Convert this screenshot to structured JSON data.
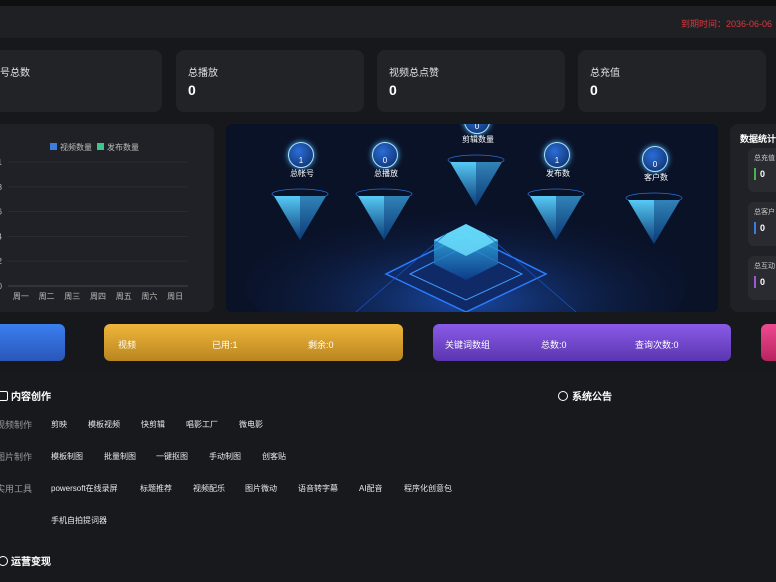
{
  "header": {
    "expire_text": "到期时间：2036-06-06"
  },
  "stats": [
    {
      "label": "号总数",
      "value": ""
    },
    {
      "label": "总播放",
      "value": "0"
    },
    {
      "label": "视频总点赞",
      "value": "0"
    },
    {
      "label": "总充值",
      "value": "0"
    }
  ],
  "chart_data": {
    "type": "bar",
    "categories": [
      "周一",
      "周二",
      "周三",
      "周四",
      "周五",
      "周六",
      "周日"
    ],
    "series": [
      {
        "name": "视频数量",
        "values": [
          0,
          0,
          0,
          0,
          0,
          0,
          0
        ],
        "color": "#3b7ddd"
      },
      {
        "name": "发布数量",
        "values": [
          0,
          0,
          0,
          0,
          0,
          0,
          0
        ],
        "color": "#3fc48a"
      }
    ],
    "yticks": [
      "1",
      "8",
      "6",
      "4",
      "2",
      "0"
    ],
    "ylim": [
      0,
      1
    ],
    "legend": "top-center",
    "grid": true
  },
  "center": {
    "nodes": [
      {
        "value": "1",
        "label": "总帐号"
      },
      {
        "value": "0",
        "label": "总播放"
      },
      {
        "value": "0",
        "label": "剪辑数量"
      },
      {
        "value": "1",
        "label": "发布数"
      },
      {
        "value": "0",
        "label": "客户数"
      }
    ]
  },
  "side": {
    "title": "数据统计",
    "cards": [
      {
        "label": "总充值",
        "value": "0",
        "color": "#4caf50"
      },
      {
        "label": "总客户",
        "value": "0",
        "color": "#3b7ddd"
      },
      {
        "label": "总互动",
        "value": "0",
        "color": "#9b59d6"
      }
    ]
  },
  "pills": {
    "video": {
      "name": "视频",
      "used": "已用:1",
      "left": "剩余:0"
    },
    "keyword": {
      "name": "关键词数组",
      "total": "总数:0",
      "queries": "查询次数:0"
    }
  },
  "content": {
    "title": "内容创作",
    "rows": [
      {
        "label": "视频制作",
        "items": [
          "剪映",
          "模板视频",
          "快剪辑",
          "唱影工厂",
          "微电影"
        ]
      },
      {
        "label": "图片制作",
        "items": [
          "模板制图",
          "批量制图",
          "一键抠图",
          "手动制图",
          "创客贴"
        ]
      },
      {
        "label": "实用工具",
        "items": [
          "powersoft在线录屏",
          "标题推荐",
          "视频配乐",
          "图片微动",
          "语音转字幕",
          "AI配音",
          "程序化创意包"
        ]
      },
      {
        "label": "",
        "items": [
          "手机自拍提词器"
        ]
      }
    ],
    "notice_title": "系统公告",
    "ops_title": "运营变现"
  },
  "colors": {
    "bg": "#17181c",
    "card": "#222327",
    "accent_red": "#e0353b",
    "pill_blue": "#2f6fd8",
    "pill_gold": "#e1a92f",
    "pill_purple": "#7b4bd6",
    "pill_pink": "#e0347d"
  }
}
